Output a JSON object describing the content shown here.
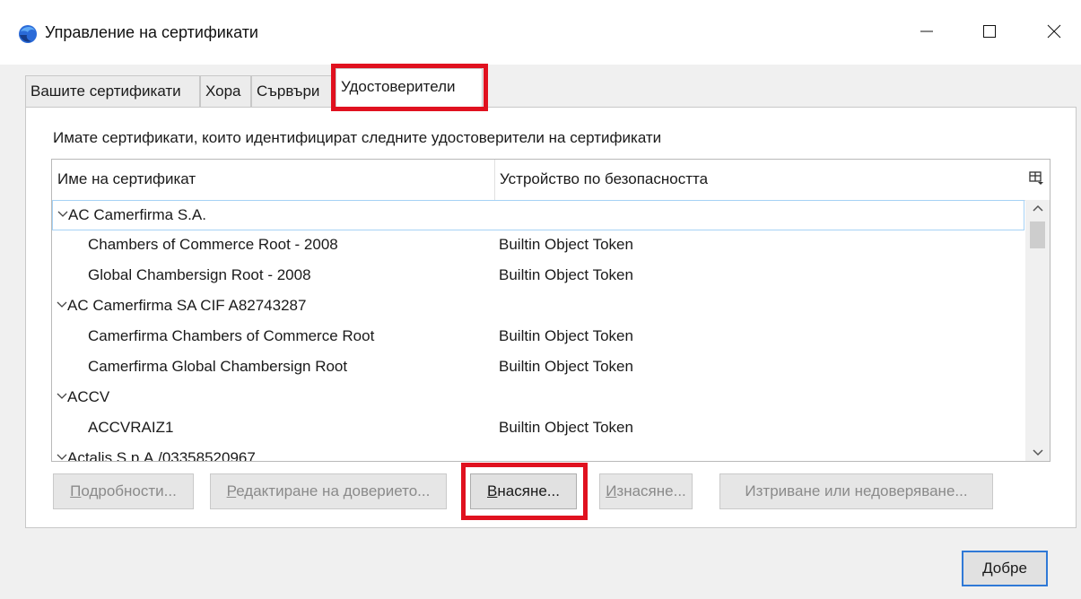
{
  "window": {
    "title": "Управление на сертификати",
    "icon": "firefox-icon",
    "controls": [
      "minimize-icon",
      "maximize-icon",
      "close-icon"
    ]
  },
  "tabs": [
    {
      "label": "Вашите сертификати",
      "active": false
    },
    {
      "label": "Хора",
      "active": false
    },
    {
      "label": "Сървъри",
      "active": false
    },
    {
      "label": "Удостоверители",
      "active": true
    }
  ],
  "panel": {
    "intro": "Имате сертификати, които идентифицират следните удостоверители на сертификати",
    "columns": [
      "Име на сертификат",
      "Устройство по безопасността"
    ],
    "rows": [
      {
        "name": "AC Camerfirma S.A.",
        "token": "",
        "group": true,
        "selected": true
      },
      {
        "name": "Chambers of Commerce Root - 2008",
        "token": "Builtin Object Token",
        "group": false
      },
      {
        "name": "Global Chambersign Root - 2008",
        "token": "Builtin Object Token",
        "group": false
      },
      {
        "name": "AC Camerfirma SA CIF A82743287",
        "token": "",
        "group": true
      },
      {
        "name": "Camerfirma Chambers of Commerce Root",
        "token": "Builtin Object Token",
        "group": false
      },
      {
        "name": "Camerfirma Global Chambersign Root",
        "token": "Builtin Object Token",
        "group": false
      },
      {
        "name": "ACCV",
        "token": "",
        "group": true
      },
      {
        "name": "ACCVRAIZ1",
        "token": "Builtin Object Token",
        "group": false
      },
      {
        "name": "Actalis S.p.A./03358520967",
        "token": "",
        "group": true
      }
    ]
  },
  "buttons": {
    "view": {
      "mnemonic": "П",
      "rest": "одробности...",
      "enabled": false
    },
    "edit": {
      "mnemonic": "Р",
      "rest": "едактиране на доверието...",
      "enabled": false
    },
    "import": {
      "mnemonic": "В",
      "rest": "насяне...",
      "enabled": true
    },
    "export": {
      "mnemonic": "И",
      "rest": "знасяне...",
      "enabled": false
    },
    "delete": {
      "label": "Изтриване или недоверяване...",
      "enabled": false
    }
  },
  "ok_button": "Добре",
  "highlight_color": "#e0111f",
  "selection_color": "#a6d2f5",
  "default_button_color": "#2f79d6"
}
